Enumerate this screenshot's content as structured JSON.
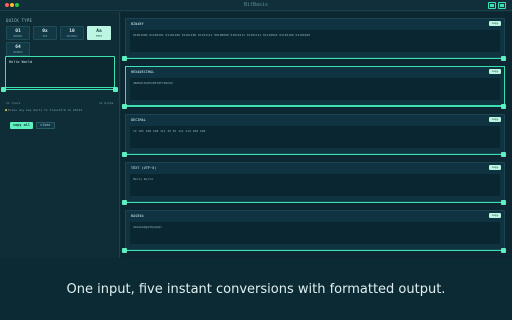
{
  "window": {
    "title": "BitBasis"
  },
  "left": {
    "section_label": "QUICK TYPE",
    "quick_types": [
      {
        "num": "01",
        "label": "BINARY",
        "active": false
      },
      {
        "num": "0x",
        "label": "HEX",
        "active": false
      },
      {
        "num": "10",
        "label": "DECIMAL",
        "active": false
      },
      {
        "num": "Aa",
        "label": "TEXT",
        "active": true
      },
      {
        "num": "64",
        "label": "BASE64",
        "active": false
      }
    ],
    "input_value": "Hello World",
    "count_left": "11 chars",
    "count_right": "11 bytes",
    "hint": "Press any key multi to transform to ASCII",
    "copy_all_label": "copy all",
    "clear_label": "clear"
  },
  "cards": [
    {
      "title": "BINARY",
      "value": "01001000 01100101 01101100 01101100 01101111 00100000 01010111 01101111 01110010 01101100 01100100",
      "copy": "copy"
    },
    {
      "title": "HEXADECIMAL",
      "value": "48656C6C6F20576F726C64",
      "copy": "copy"
    },
    {
      "title": "DECIMAL",
      "value": "72 101 108 108 111 32 87 111 114 108 100",
      "copy": "copy"
    },
    {
      "title": "TEXT (UTF-8)",
      "value": "Hello World",
      "copy": "copy"
    },
    {
      "title": "BASE64",
      "value": "SGVsbG8gV29ybGQ=",
      "copy": "copy"
    }
  ],
  "caption": "One input, five instant conversions with formatted output."
}
